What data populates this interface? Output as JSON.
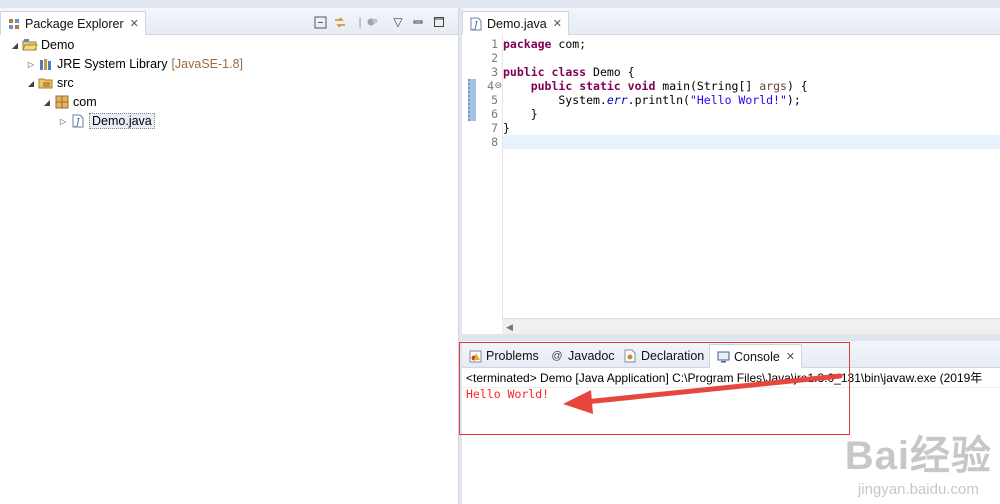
{
  "explorer": {
    "tab_label": "Package Explorer",
    "tree": {
      "project": "Demo",
      "jre": "JRE System Library",
      "jre_decoration": "[JavaSE-1.8]",
      "src": "src",
      "package": "com",
      "file": "Demo.java"
    }
  },
  "editor": {
    "tab_label": "Demo.java",
    "line_numbers": [
      "1",
      "2",
      "3",
      "4",
      "5",
      "6",
      "7",
      "8"
    ]
  },
  "bottom_tabs": {
    "problems": "Problems",
    "javadoc": "Javadoc",
    "declaration": "Declaration",
    "console": "Console"
  },
  "console": {
    "header": "<terminated> Demo [Java Application] C:\\Program Files\\Java\\jre1.8.0_131\\bin\\javaw.exe (2019年",
    "output": "Hello World!"
  },
  "watermark": {
    "brand": "Bai经验",
    "url": "jingyan.baidu.com"
  },
  "colors": {
    "annotation": "#e03a3a",
    "stderr": "#ff2222",
    "keyword": "#7f0055",
    "string": "#2a00ff"
  }
}
